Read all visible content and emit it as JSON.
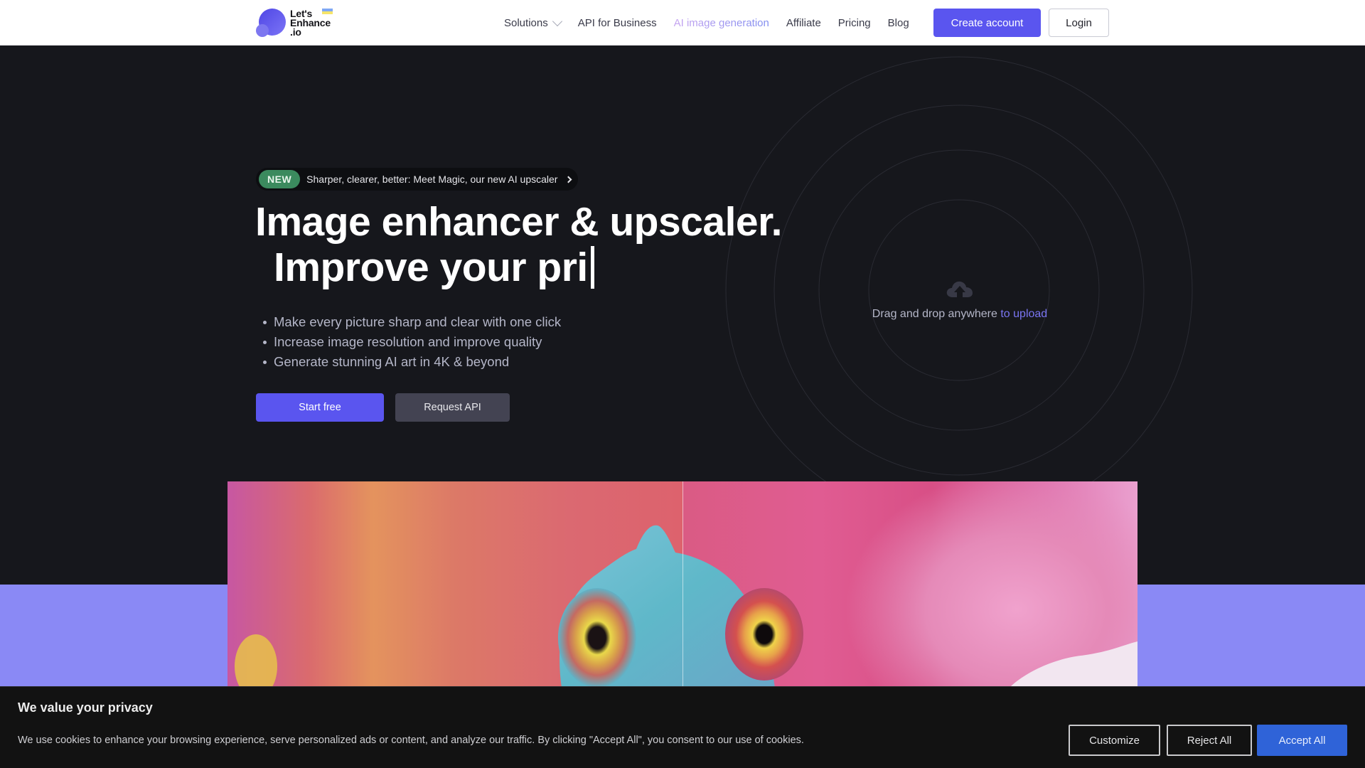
{
  "header": {
    "logo": {
      "line1": "Let's",
      "line2": "Enhance",
      "line3": ".io"
    },
    "nav": [
      {
        "label": "Solutions",
        "has_dropdown": true
      },
      {
        "label": "API for Business"
      },
      {
        "label": "AI image generation",
        "highlighted": true
      },
      {
        "label": "Affiliate"
      },
      {
        "label": "Pricing"
      },
      {
        "label": "Blog"
      }
    ],
    "create_account_label": "Create account",
    "login_label": "Login"
  },
  "hero": {
    "badge": {
      "tag": "NEW",
      "text": "Sharper, clearer, better: Meet Magic, our new AI upscaler"
    },
    "headline_line1": "Image enhancer & upscaler.",
    "headline_line2": "Improve your pri",
    "bullets": [
      "Make every picture sharp and clear with one click",
      "Increase image resolution and improve quality",
      "Generate stunning AI art in 4K & beyond"
    ],
    "start_free_label": "Start free",
    "request_api_label": "Request API",
    "upload": {
      "icon": "cloud-upload-icon",
      "text": "Drag and drop anywhere",
      "link": "to upload"
    }
  },
  "cookie_banner": {
    "title": "We value your privacy",
    "text": "We use cookies to enhance your browsing experience, serve personalized ads or content, and analyze our traffic. By clicking \"Accept All\", you consent to our use of cookies.",
    "customize_label": "Customize",
    "reject_label": "Reject All",
    "accept_label": "Accept All"
  },
  "colors": {
    "accent": "#5a55ef",
    "hero_bg": "#16171c",
    "purple_band": "#8a89f5",
    "new_badge": "#3b8a5e",
    "accept_button": "#2f63d8"
  }
}
